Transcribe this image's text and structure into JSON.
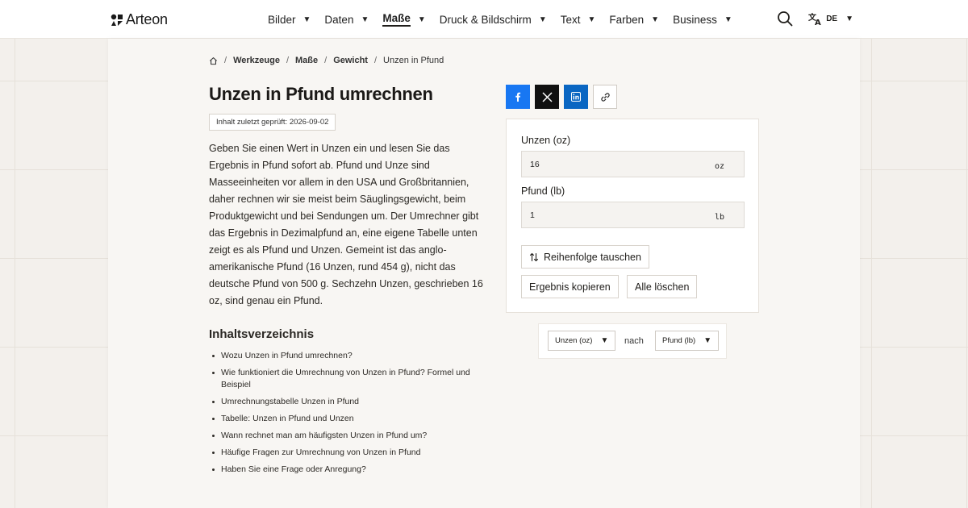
{
  "brand": {
    "name": "Arteon"
  },
  "nav": {
    "items": [
      {
        "label": "Bilder",
        "active": false
      },
      {
        "label": "Daten",
        "active": false
      },
      {
        "label": "Maße",
        "active": true
      },
      {
        "label": "Druck & Bildschirm",
        "active": false
      },
      {
        "label": "Text",
        "active": false
      },
      {
        "label": "Farben",
        "active": false
      },
      {
        "label": "Business",
        "active": false
      }
    ],
    "caret": "▼",
    "language": "DE"
  },
  "breadcrumb": {
    "items": [
      "Werkzeuge",
      "Maße",
      "Gewicht"
    ],
    "current": "Unzen in Pfund",
    "separator": "/"
  },
  "page": {
    "title": "Unzen in Pfund umrechnen",
    "badge": "Inhalt zuletzt geprüft: 2026-09-02",
    "intro": "Geben Sie einen Wert in Unzen ein und lesen Sie das Ergebnis in Pfund sofort ab. Pfund und Unze sind Masseeinheiten vor allem in den USA und Großbritannien, daher rechnen wir sie meist beim Säuglingsgewicht, beim Produktgewicht und bei Sendungen um. Der Umrechner gibt das Ergebnis in Dezimalpfund an, eine eigene Tabelle unten zeigt es als Pfund und Unzen. Gemeint ist das anglo-amerikanische Pfund (16 Unzen, rund 454 g), nicht das deutsche Pfund von 500 g. Sechzehn Unzen, geschrieben 16 oz, sind genau ein Pfund."
  },
  "toc": {
    "title": "Inhaltsverzeichnis",
    "items": [
      "Wozu Unzen in Pfund umrechnen?",
      "Wie funktioniert die Umrechnung von Unzen in Pfund? Formel und Beispiel",
      "Umrechnungstabelle Unzen in Pfund",
      "Tabelle: Unzen in Pfund und Unzen",
      "Wann rechnet man am häufigsten Unzen in Pfund um?",
      "Häufige Fragen zur Umrechnung von Unzen in Pfund",
      "Haben Sie eine Frage oder Anregung?"
    ]
  },
  "share": {
    "icons": [
      "facebook-icon",
      "x-icon",
      "linkedin-icon",
      "link-icon"
    ],
    "colors": {
      "facebook": "#1877f2",
      "x": "#111111",
      "linkedin": "#0a66c2"
    }
  },
  "converter": {
    "from_label": "Unzen (oz)",
    "from_value": "16",
    "from_unit": "oz",
    "to_label": "Pfund (lb)",
    "to_value": "1",
    "to_unit": "lb",
    "swap_label": "Reihenfolge tauschen",
    "copy_label": "Ergebnis kopieren",
    "clear_label": "Alle löschen"
  },
  "unit_select": {
    "from": "Unzen (oz)",
    "connector": "nach",
    "to": "Pfund (lb)"
  }
}
